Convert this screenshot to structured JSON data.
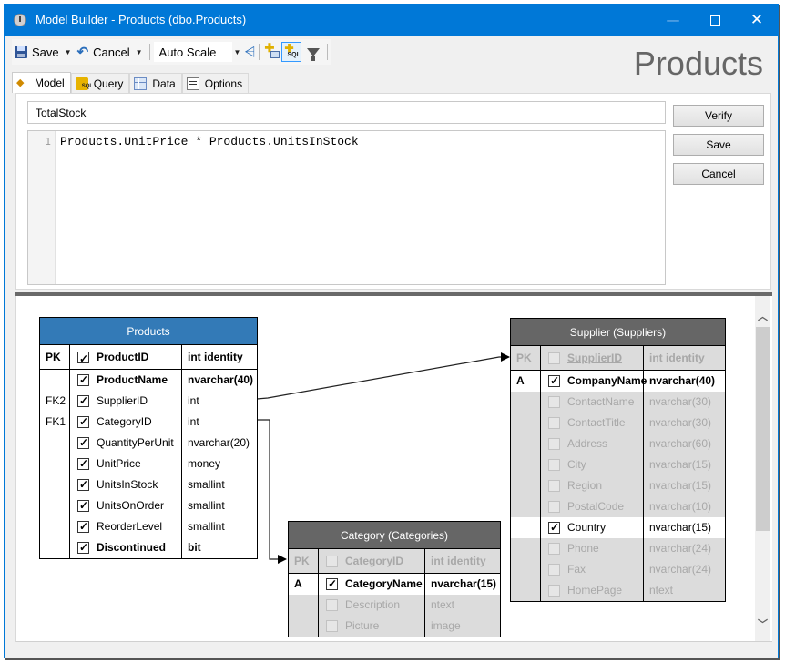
{
  "window": {
    "title": "Model Builder - Products (dbo.Products)",
    "controls": {
      "minimize": "—",
      "maximize": "☐",
      "close": "✕"
    }
  },
  "toolbar": {
    "save_label": "Save",
    "cancel_label": "Cancel",
    "scale_value": "Auto Scale",
    "dropdown_glyph": "▼",
    "tree_glyph": "⩤",
    "add_plus": "✚",
    "add_sql_text": "SQL"
  },
  "header_title": "Products",
  "tabs": [
    {
      "label": "Model",
      "icon": "model-icon",
      "glyph": "◆"
    },
    {
      "label": "Query",
      "icon": "query-icon"
    },
    {
      "label": "Data",
      "icon": "data-icon"
    },
    {
      "label": "Options",
      "icon": "options-icon"
    }
  ],
  "editor": {
    "field_name": "TotalStock",
    "line_number": "1",
    "code": "Products.UnitPrice * Products.UnitsInStock"
  },
  "buttons": {
    "verify": "Verify",
    "save": "Save",
    "cancel": "Cancel"
  },
  "scrollbar": {
    "up": "︿",
    "down": "﹀"
  },
  "entities": {
    "products": {
      "title": "Products",
      "header_color": "#337ab7",
      "pk": {
        "key": "PK",
        "name": "ProductID",
        "type": "int identity",
        "checked": true
      },
      "rows": [
        {
          "key": "",
          "name": "ProductName",
          "type": "nvarchar(40)",
          "checked": true,
          "bold": true
        },
        {
          "key": "FK2",
          "name": "SupplierID",
          "type": "int",
          "checked": true
        },
        {
          "key": "FK1",
          "name": "CategoryID",
          "type": "int",
          "checked": true
        },
        {
          "key": "",
          "name": "QuantityPerUnit",
          "type": "nvarchar(20)",
          "checked": true
        },
        {
          "key": "",
          "name": "UnitPrice",
          "type": "money",
          "checked": true
        },
        {
          "key": "",
          "name": "UnitsInStock",
          "type": "smallint",
          "checked": true
        },
        {
          "key": "",
          "name": "UnitsOnOrder",
          "type": "smallint",
          "checked": true
        },
        {
          "key": "",
          "name": "ReorderLevel",
          "type": "smallint",
          "checked": true
        },
        {
          "key": "",
          "name": "Discontinued",
          "type": "bit",
          "checked": true,
          "bold": true
        }
      ]
    },
    "category": {
      "title": "Category (Categories)",
      "header_color": "#666666",
      "pk": {
        "key": "PK",
        "name": "CategoryID",
        "type": "int identity",
        "checked": false
      },
      "rows": [
        {
          "key": "A",
          "name": "CategoryName",
          "type": "nvarchar(15)",
          "checked": true,
          "bold": true
        },
        {
          "key": "",
          "name": "Description",
          "type": "ntext",
          "checked": false
        },
        {
          "key": "",
          "name": "Picture",
          "type": "image",
          "checked": false
        }
      ]
    },
    "supplier": {
      "title": "Supplier (Suppliers)",
      "header_color": "#666666",
      "pk": {
        "key": "PK",
        "name": "SupplierID",
        "type": "int identity",
        "checked": false
      },
      "rows": [
        {
          "key": "A",
          "name": "CompanyName",
          "type": "nvarchar(40)",
          "checked": true,
          "bold": true
        },
        {
          "key": "",
          "name": "ContactName",
          "type": "nvarchar(30)",
          "checked": false
        },
        {
          "key": "",
          "name": "ContactTitle",
          "type": "nvarchar(30)",
          "checked": false
        },
        {
          "key": "",
          "name": "Address",
          "type": "nvarchar(60)",
          "checked": false
        },
        {
          "key": "",
          "name": "City",
          "type": "nvarchar(15)",
          "checked": false
        },
        {
          "key": "",
          "name": "Region",
          "type": "nvarchar(15)",
          "checked": false
        },
        {
          "key": "",
          "name": "PostalCode",
          "type": "nvarchar(10)",
          "checked": false
        },
        {
          "key": "",
          "name": "Country",
          "type": "nvarchar(15)",
          "checked": true
        },
        {
          "key": "",
          "name": "Phone",
          "type": "nvarchar(24)",
          "checked": false
        },
        {
          "key": "",
          "name": "Fax",
          "type": "nvarchar(24)",
          "checked": false
        },
        {
          "key": "",
          "name": "HomePage",
          "type": "ntext",
          "checked": false
        }
      ]
    }
  },
  "relationships": [
    {
      "from": "Products.SupplierID",
      "to": "Supplier.SupplierID"
    },
    {
      "from": "Products.CategoryID",
      "to": "Category.CategoryID"
    }
  ]
}
